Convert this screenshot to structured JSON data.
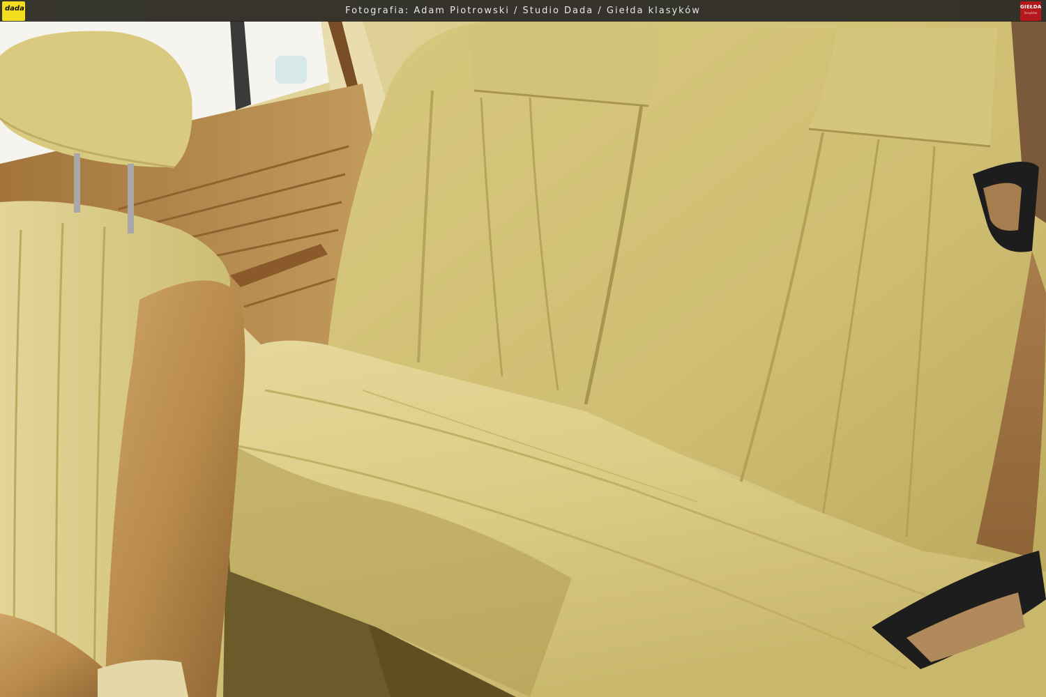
{
  "caption": "Fotografia: Adam Piotrowski / Studio Dada / Giełda klasyków",
  "logo_left": {
    "text": "dada",
    "color": "#f2de1e"
  },
  "logo_right": {
    "line1": "GIEŁDA",
    "line2": "klasyków",
    "color": "#b3191c"
  },
  "colors": {
    "fabric": "#d9c97e",
    "fabric_shadow": "#b9a85a",
    "leather": "#b88a4b",
    "door_trim": "#9a6a35",
    "carpet": "#6b5a2a",
    "belt": "#a67d4e",
    "topbar": "#1e1e1e"
  }
}
